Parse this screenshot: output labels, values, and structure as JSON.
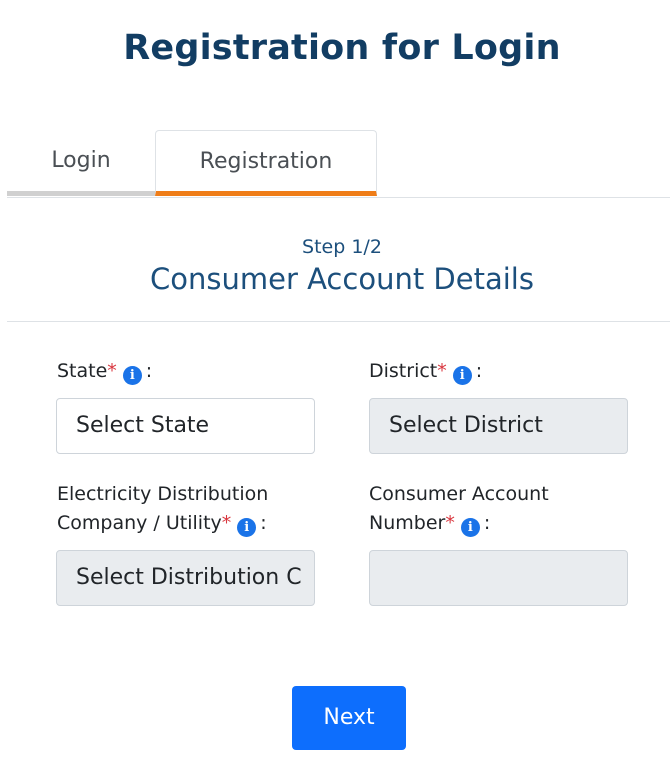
{
  "page_title": "Registration for Login",
  "tabs": {
    "login_label": "Login",
    "registration_label": "Registration",
    "active": "Registration"
  },
  "step": {
    "indicator": "Step 1/2",
    "title": "Consumer Account Details"
  },
  "form": {
    "state": {
      "label": "State",
      "required_mark": "*",
      "colon": ":",
      "placeholder": "Select State"
    },
    "district": {
      "label": "District",
      "required_mark": "*",
      "colon": ":",
      "placeholder": "Select District"
    },
    "utility": {
      "label_line1": "Electricity Distribution",
      "label_line2": "Company / Utility",
      "required_mark": "*",
      "colon": ":",
      "placeholder": "Select Distribution C"
    },
    "account_number": {
      "label_line1": "Consumer Account",
      "label_line2": "Number",
      "required_mark": "*",
      "colon": ":",
      "value": ""
    }
  },
  "actions": {
    "next_label": "Next"
  },
  "icons": {
    "info": "info-icon"
  },
  "colors": {
    "title": "#123d63",
    "accent_tab": "#ef7d18",
    "primary_button": "#0d6efd",
    "required": "#d9363e",
    "info_icon": "#1a73e8",
    "disabled_field": "#e9ecef"
  }
}
